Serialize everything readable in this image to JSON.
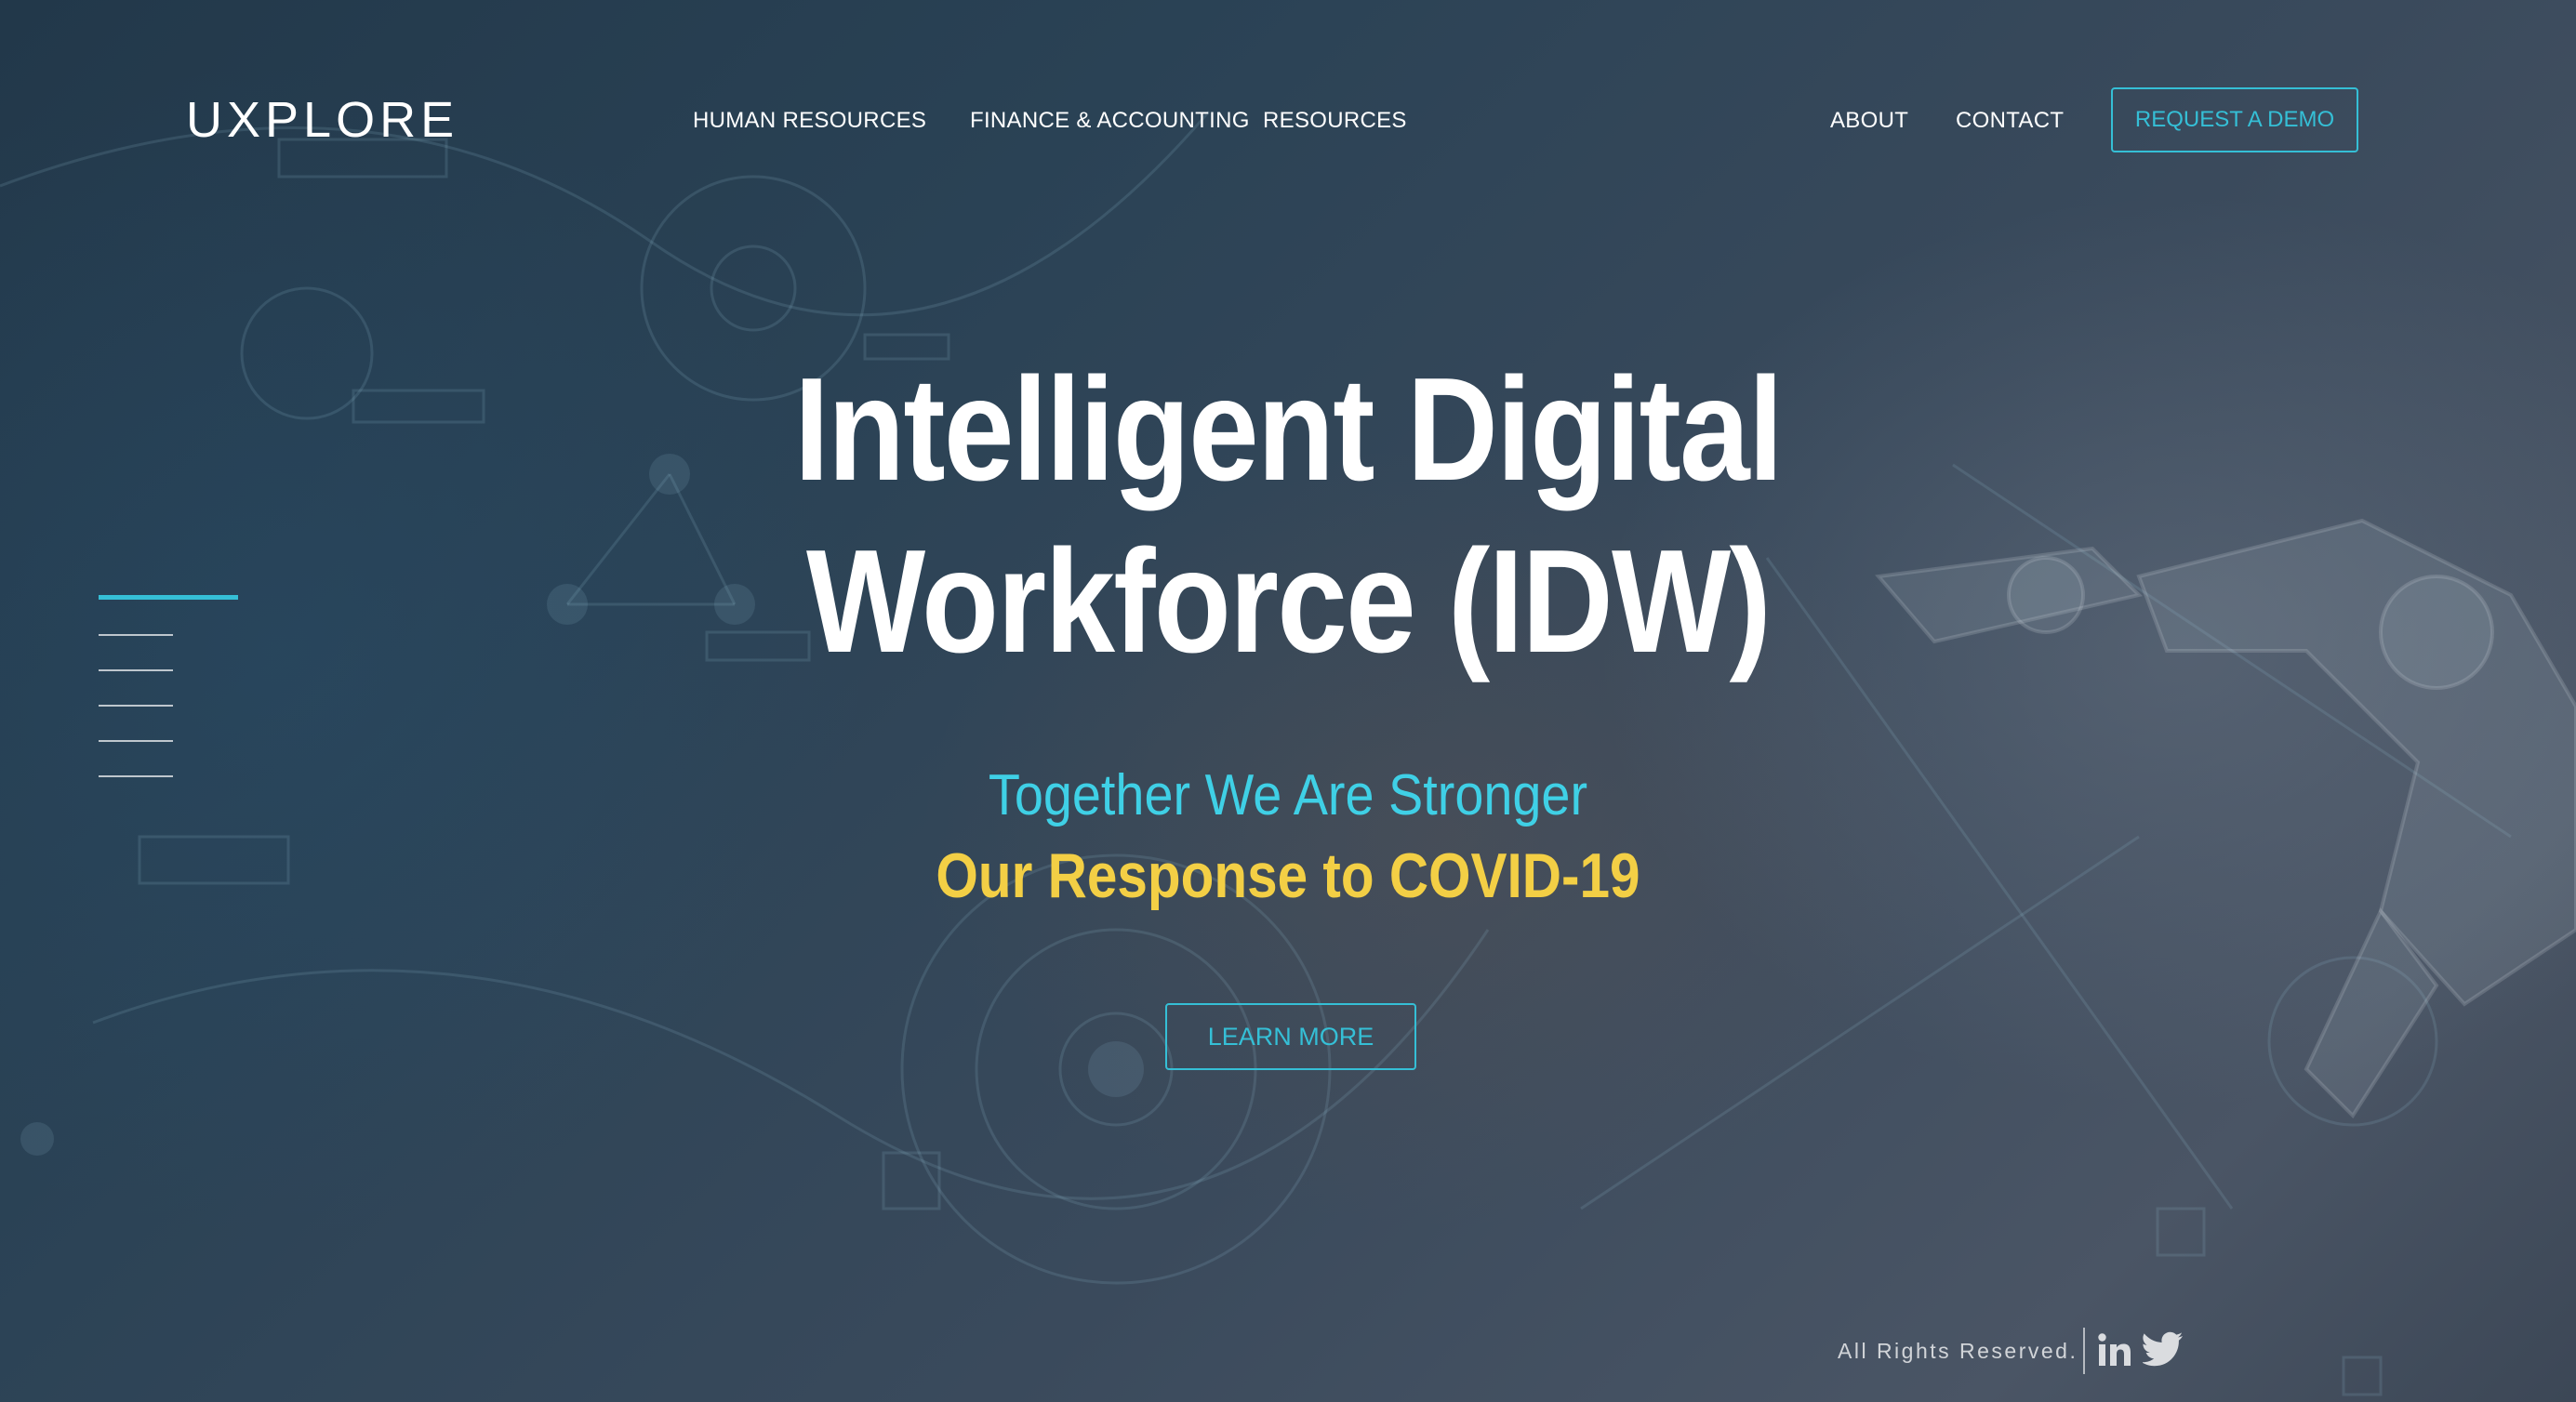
{
  "brand": {
    "logo": "UXPLORE"
  },
  "nav": {
    "left": [
      {
        "label": "HUMAN RESOURCES"
      },
      {
        "label": "FINANCE & ACCOUNTING"
      },
      {
        "label": "RESOURCES"
      }
    ],
    "right": [
      {
        "label": "ABOUT"
      },
      {
        "label": "CONTACT"
      }
    ],
    "cta": "REQUEST A DEMO"
  },
  "hero": {
    "headline_line1": "Intelligent Digital",
    "headline_line2": "Workforce (IDW)",
    "tagline": "Together We Are Stronger",
    "subheadline": "Our Response to COVID-19",
    "button": "LEARN MORE"
  },
  "slider": {
    "total_slides": 6,
    "active_index": 0
  },
  "footer": {
    "rights": "All Rights Reserved.",
    "social": [
      {
        "icon": "linkedin-icon"
      },
      {
        "icon": "twitter-icon"
      }
    ]
  },
  "colors": {
    "accent": "#35bfd6",
    "tagline": "#3fd0e6",
    "highlight": "#f3cf45",
    "background": "#2f3d4c"
  }
}
